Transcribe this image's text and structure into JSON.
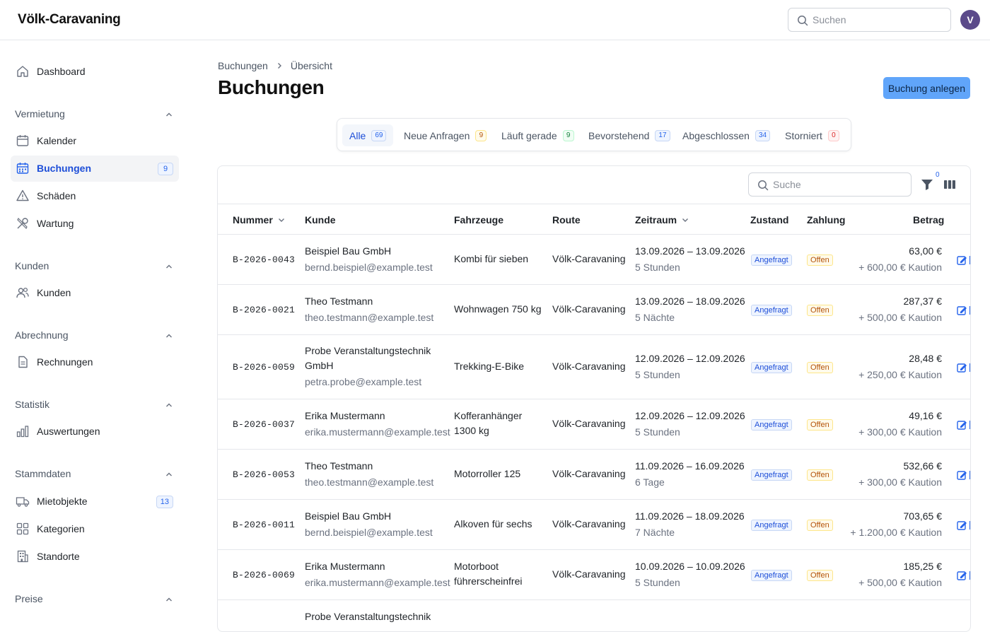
{
  "app": {
    "title": "Völk-Caravaning",
    "avatar_initial": "V"
  },
  "topbar": {
    "search_placeholder": "Suchen"
  },
  "sidebar": {
    "dashboard": "Dashboard",
    "sections": {
      "vermietung": "Vermietung",
      "kunden": "Kunden",
      "abrechnung": "Abrechnung",
      "statistik": "Statistik",
      "stammdaten": "Stammdaten",
      "preise": "Preise"
    },
    "items": {
      "kalender": "Kalender",
      "buchungen": "Buchungen",
      "buchungen_badge": "9",
      "schaeden": "Schäden",
      "wartung": "Wartung",
      "kunden": "Kunden",
      "rechnungen": "Rechnungen",
      "auswertungen": "Auswertungen",
      "mietobjekte": "Mietobjekte",
      "mietobjekte_badge": "13",
      "kategorien": "Kategorien",
      "standorte": "Standorte"
    }
  },
  "breadcrumb": {
    "parent": "Buchungen",
    "current": "Übersicht"
  },
  "page": {
    "title": "Buchungen",
    "add_button": "Buchung anlegen"
  },
  "tabs": [
    {
      "label": "Alle",
      "count": "69"
    },
    {
      "label": "Neue Anfragen",
      "count": "9"
    },
    {
      "label": "Läuft gerade",
      "count": "9"
    },
    {
      "label": "Bevorstehend",
      "count": "17"
    },
    {
      "label": "Abgeschlossen",
      "count": "34"
    },
    {
      "label": "Storniert",
      "count": "0"
    }
  ],
  "table": {
    "search_placeholder": "Suche",
    "filter_count": "0",
    "columns": {
      "nummer": "Nummer",
      "kunde": "Kunde",
      "fahrzeuge": "Fahrzeuge",
      "route": "Route",
      "zeitraum": "Zeitraum",
      "zustand": "Zustand",
      "zahlung": "Zahlung",
      "betrag": "Betrag"
    },
    "rows": [
      {
        "nummer": "B-2026-0043",
        "kunde": "Beispiel Bau GmbH",
        "kunde2": "",
        "email": "bernd.beispiel@example.test",
        "fahrzeug": "Kombi für sieben",
        "fahrzeug2": "",
        "route": "Völk-Caravaning",
        "zeitraum": "13.09.2026 – 13.09.2026",
        "dauer": "5 Stunden",
        "zustand": "Angefragt",
        "zahlung": "Offen",
        "betrag": "63,00 €",
        "kaution": "+ 600,00 € Kaution"
      },
      {
        "nummer": "B-2026-0021",
        "kunde": "Theo Testmann",
        "kunde2": "",
        "email": "theo.testmann@example.test",
        "fahrzeug": "Wohnwagen 750 kg",
        "fahrzeug2": "",
        "route": "Völk-Caravaning",
        "zeitraum": "13.09.2026 – 18.09.2026",
        "dauer": "5 Nächte",
        "zustand": "Angefragt",
        "zahlung": "Offen",
        "betrag": "287,37 €",
        "kaution": "+ 500,00 € Kaution"
      },
      {
        "nummer": "B-2026-0059",
        "kunde": "Probe Veranstaltungstechnik",
        "kunde2": "GmbH",
        "email": "petra.probe@example.test",
        "fahrzeug": "Trekking-E-Bike",
        "fahrzeug2": "",
        "route": "Völk-Caravaning",
        "zeitraum": "12.09.2026 – 12.09.2026",
        "dauer": "5 Stunden",
        "zustand": "Angefragt",
        "zahlung": "Offen",
        "betrag": "28,48 €",
        "kaution": "+ 250,00 € Kaution"
      },
      {
        "nummer": "B-2026-0037",
        "kunde": "Erika Mustermann",
        "kunde2": "",
        "email": "erika.mustermann@example.test",
        "fahrzeug": "Kofferanhänger",
        "fahrzeug2": "1300 kg",
        "route": "Völk-Caravaning",
        "zeitraum": "12.09.2026 – 12.09.2026",
        "dauer": "5 Stunden",
        "zustand": "Angefragt",
        "zahlung": "Offen",
        "betrag": "49,16 €",
        "kaution": "+ 300,00 € Kaution"
      },
      {
        "nummer": "B-2026-0053",
        "kunde": "Theo Testmann",
        "kunde2": "",
        "email": "theo.testmann@example.test",
        "fahrzeug": "Motorroller 125",
        "fahrzeug2": "",
        "route": "Völk-Caravaning",
        "zeitraum": "11.09.2026 – 16.09.2026",
        "dauer": "6 Tage",
        "zustand": "Angefragt",
        "zahlung": "Offen",
        "betrag": "532,66 €",
        "kaution": "+ 300,00 € Kaution"
      },
      {
        "nummer": "B-2026-0011",
        "kunde": "Beispiel Bau GmbH",
        "kunde2": "",
        "email": "bernd.beispiel@example.test",
        "fahrzeug": "Alkoven für sechs",
        "fahrzeug2": "",
        "route": "Völk-Caravaning",
        "zeitraum": "11.09.2026 – 18.09.2026",
        "dauer": "7 Nächte",
        "zustand": "Angefragt",
        "zahlung": "Offen",
        "betrag": "703,65 €",
        "kaution": "+ 1.200,00 € Kaution"
      },
      {
        "nummer": "B-2026-0069",
        "kunde": "Erika Mustermann",
        "kunde2": "",
        "email": "erika.mustermann@example.test",
        "fahrzeug": "Motorboot",
        "fahrzeug2": "führerscheinfrei",
        "route": "Völk-Caravaning",
        "zeitraum": "10.09.2026 – 10.09.2026",
        "dauer": "5 Stunden",
        "zustand": "Angefragt",
        "zahlung": "Offen",
        "betrag": "185,25 €",
        "kaution": "+ 500,00 € Kaution"
      },
      {
        "nummer": "",
        "kunde": "Probe Veranstaltungstechnik",
        "kunde2": "",
        "email": "",
        "fahrzeug": "",
        "fahrzeug2": "",
        "route": "",
        "zeitraum": "",
        "dauer": "",
        "zustand": "",
        "zahlung": "",
        "betrag": "",
        "kaution": ""
      }
    ]
  }
}
